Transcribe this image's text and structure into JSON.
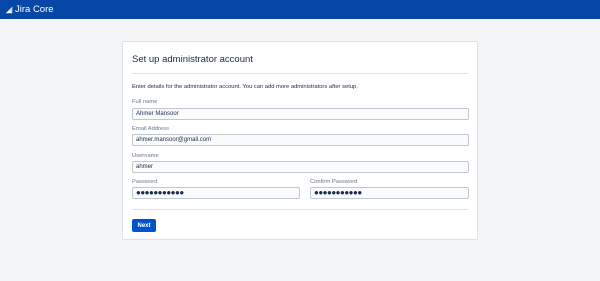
{
  "header": {
    "app_name": "Jira Core",
    "logo_icon": "jira-logo-icon",
    "bar_color": "#0747a6"
  },
  "form": {
    "title": "Set up administrator account",
    "description": "Enter details for the administrator account. You can add more administrators after setup.",
    "fields": {
      "full_name": {
        "label": "Full name",
        "value": "Ahmer Mansoor"
      },
      "email": {
        "label": "Email Address",
        "value": "ahmer.mansoor@gmail.com"
      },
      "username": {
        "label": "Username",
        "value": "ahmer"
      },
      "password": {
        "label": "Password",
        "value": "●●●●●●●●●●●"
      },
      "confirm_password": {
        "label": "Confirm Password",
        "value": "●●●●●●●●●●●"
      }
    },
    "next_label": "Next",
    "accent_color": "#0052cc"
  }
}
